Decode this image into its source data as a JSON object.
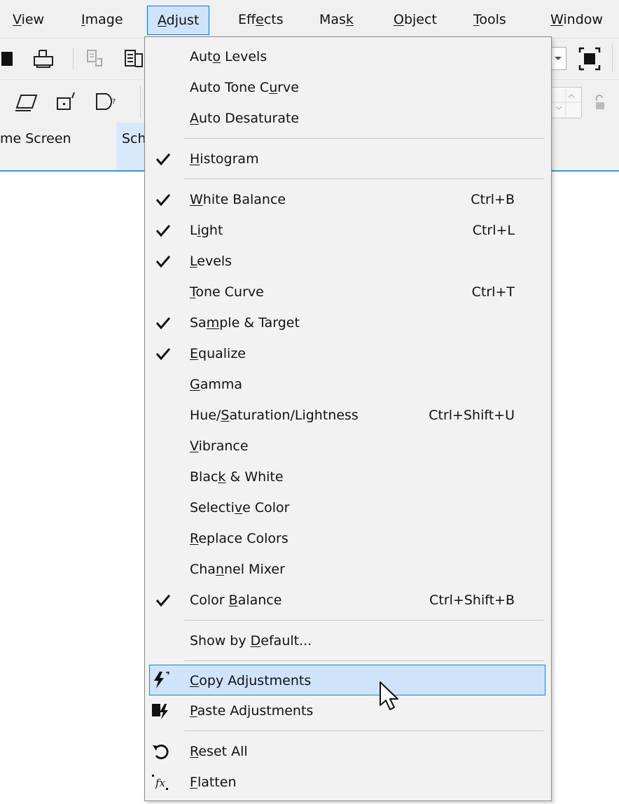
{
  "menubar": {
    "items": [
      {
        "label": "View",
        "ul": "V",
        "rest": "iew"
      },
      {
        "label": "Image",
        "ul": "I",
        "rest": "mage"
      },
      {
        "label": "Adjust",
        "ul": "A",
        "rest": "djust"
      },
      {
        "label": "Effects",
        "pre": "Eff",
        "ul": "e",
        "rest": "cts"
      },
      {
        "label": "Mask",
        "pre": "Mas",
        "ul": "k",
        "rest": ""
      },
      {
        "label": "Object",
        "ul": "O",
        "rest": "bject"
      },
      {
        "label": "Tools",
        "ul": "T",
        "rest": "ools"
      },
      {
        "label": "Window",
        "ul": "W",
        "rest": "indow"
      }
    ]
  },
  "toolbar": {
    "icons": [
      "save-icon",
      "print-icon",
      "copy-merged-icon",
      "paste-icon",
      "dropdown-arrow-icon",
      "fit-window-icon",
      "perspective-icon",
      "transform-icon",
      "shape-icon",
      "spin-up-icon",
      "spin-down-icon",
      "lock-icon"
    ]
  },
  "tabs": [
    {
      "label": "me Screen"
    },
    {
      "label": "Sch"
    }
  ],
  "adjust_menu": {
    "group1": [
      {
        "pre": "Aut",
        "ul": "o",
        "post": " Levels",
        "checked": false
      },
      {
        "pre": "Auto Tone C",
        "ul": "u",
        "post": "rve",
        "checked": false
      },
      {
        "pre": "",
        "ul": "A",
        "post": "uto Desaturate",
        "checked": false
      }
    ],
    "group2": [
      {
        "pre": "",
        "ul": "H",
        "post": "istogram",
        "checked": true
      }
    ],
    "group3": [
      {
        "pre": "",
        "ul": "W",
        "post": "hite Balance",
        "shortcut": "Ctrl+B",
        "checked": true
      },
      {
        "pre": "L",
        "ul": "i",
        "post": "ght",
        "shortcut": "Ctrl+L",
        "checked": true
      },
      {
        "pre": "",
        "ul": "L",
        "post": "evels",
        "shortcut": "",
        "checked": true
      },
      {
        "pre": "",
        "ul": "T",
        "post": "one Curve",
        "shortcut": "Ctrl+T",
        "checked": false
      },
      {
        "pre": "Sa",
        "ul": "m",
        "post": "ple & Target",
        "shortcut": "",
        "checked": true
      },
      {
        "pre": "",
        "ul": "E",
        "post": "qualize",
        "shortcut": "",
        "checked": true
      },
      {
        "pre": "",
        "ul": "G",
        "post": "amma",
        "shortcut": "",
        "checked": false
      },
      {
        "pre": "Hue/",
        "ul": "S",
        "post": "aturation/Lightness",
        "shortcut": "Ctrl+Shift+U",
        "checked": false
      },
      {
        "pre": "",
        "ul": "V",
        "post": "ibrance",
        "shortcut": "",
        "checked": false
      },
      {
        "pre": "Blac",
        "ul": "k",
        "post": " & White",
        "shortcut": "",
        "checked": false
      },
      {
        "pre": "Selecti",
        "ul": "v",
        "post": "e Color",
        "shortcut": "",
        "checked": false
      },
      {
        "pre": "",
        "ul": "R",
        "post": "eplace Colors",
        "shortcut": "",
        "checked": false
      },
      {
        "pre": "Cha",
        "ul": "n",
        "post": "nel Mixer",
        "shortcut": "",
        "checked": false
      },
      {
        "pre": "Color ",
        "ul": "B",
        "post": "alance",
        "shortcut": "Ctrl+Shift+B",
        "checked": true
      }
    ],
    "group4": [
      {
        "pre": "Show by ",
        "ul": "D",
        "post": "efault...",
        "checked": false
      }
    ],
    "group5": [
      {
        "pre": "",
        "ul": "C",
        "post": "opy Adjustments",
        "icon": "copy-adjustments-icon",
        "highlighted": true
      },
      {
        "pre": "",
        "ul": "P",
        "post": "aste Adjustments",
        "icon": "paste-adjustments-icon",
        "highlighted": false
      }
    ],
    "group6": [
      {
        "pre": "",
        "ul": "R",
        "post": "eset All",
        "icon": "reset-icon"
      },
      {
        "pre": "",
        "ul": "F",
        "post": "latten",
        "icon": "flatten-icon"
      }
    ]
  },
  "colors": {
    "menu_bg": "#f2f2f2",
    "highlight_bg": "#cfe4fb",
    "highlight_border": "#2a7fd4",
    "tab_accent": "#3a95e0"
  }
}
